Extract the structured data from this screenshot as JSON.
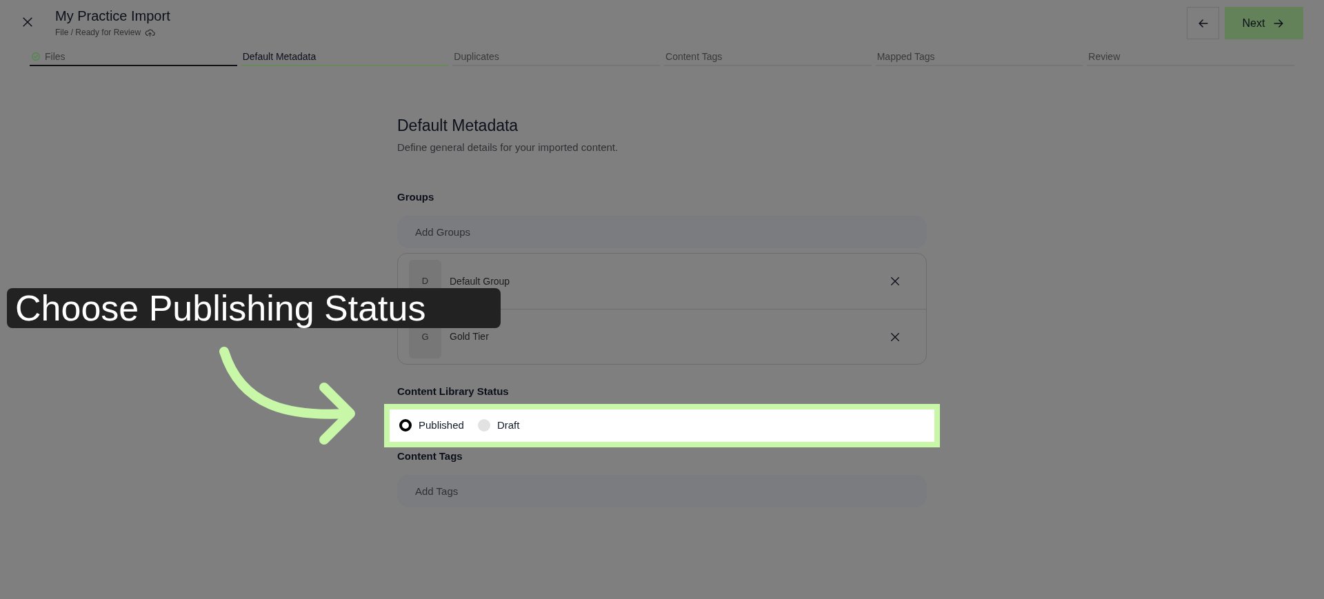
{
  "header": {
    "title": "My Practice Import",
    "subtitle": "File / Ready for Review",
    "next_label": "Next"
  },
  "steps": [
    {
      "label": "Files",
      "selected": false,
      "completed": true
    },
    {
      "label": "Default Metadata",
      "selected": true,
      "completed": false
    },
    {
      "label": "Duplicates",
      "selected": false,
      "completed": false
    },
    {
      "label": "Content Tags",
      "selected": false,
      "completed": false
    },
    {
      "label": "Mapped Tags",
      "selected": false,
      "completed": false
    },
    {
      "label": "Review",
      "selected": false,
      "completed": false
    }
  ],
  "section": {
    "title": "Default Metadata",
    "description": "Define general details for your imported content."
  },
  "groups": {
    "label": "Groups",
    "placeholder": "Add Groups",
    "items": [
      {
        "initial": "D",
        "name": "Default Group"
      },
      {
        "initial": "G",
        "name": "Gold Tier"
      }
    ]
  },
  "status": {
    "label": "Content Library Status",
    "options": [
      {
        "label": "Published",
        "selected": true
      },
      {
        "label": "Draft",
        "selected": false
      }
    ]
  },
  "tags": {
    "label": "Content Tags",
    "placeholder": "Add Tags"
  },
  "callout": {
    "text": "Choose Publishing Status"
  }
}
